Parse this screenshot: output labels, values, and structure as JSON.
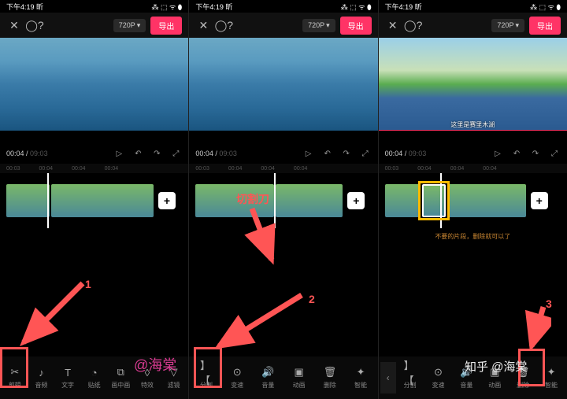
{
  "status": {
    "time": "下午4:19",
    "app": "昕",
    "icons": "⁂ ⬚ ᯤ ⬮"
  },
  "topbar": {
    "resolution": "720P",
    "export": "导出"
  },
  "playback": {
    "current": "00:04",
    "total": "09:03"
  },
  "ruler_ticks": [
    "00:03",
    "00:04",
    "00:04",
    "00:04",
    "00:04"
  ],
  "subtitle": "这里是赛里木湖",
  "hint_text": "不要的片段，删除就可以了",
  "tools_main": [
    {
      "id": "cut",
      "label": "剪辑",
      "icon": "scissors"
    },
    {
      "id": "audio",
      "label": "音频",
      "icon": "note"
    },
    {
      "id": "text",
      "label": "文字",
      "icon": "T"
    },
    {
      "id": "sticker",
      "label": "贴纸",
      "icon": "clock"
    },
    {
      "id": "pip",
      "label": "画中画",
      "icon": "pip"
    },
    {
      "id": "effect",
      "label": "特效",
      "icon": "fx"
    },
    {
      "id": "filter",
      "label": "滤镜",
      "icon": "filter"
    }
  ],
  "tools_clip": [
    {
      "id": "split",
      "label": "分割",
      "icon": "split"
    },
    {
      "id": "speed",
      "label": "变速",
      "icon": "speed"
    },
    {
      "id": "volume",
      "label": "音量",
      "icon": "vol"
    },
    {
      "id": "anim",
      "label": "动画",
      "icon": "anim"
    },
    {
      "id": "delete",
      "label": "删除",
      "icon": "trash"
    },
    {
      "id": "smart",
      "label": "智能",
      "icon": "smart"
    }
  ],
  "annotations": {
    "split_label": "切割刀",
    "num1": "1",
    "num2": "2",
    "num3": "3"
  },
  "watermarks": {
    "left": "@海棠",
    "right": "知乎 @海棠"
  }
}
